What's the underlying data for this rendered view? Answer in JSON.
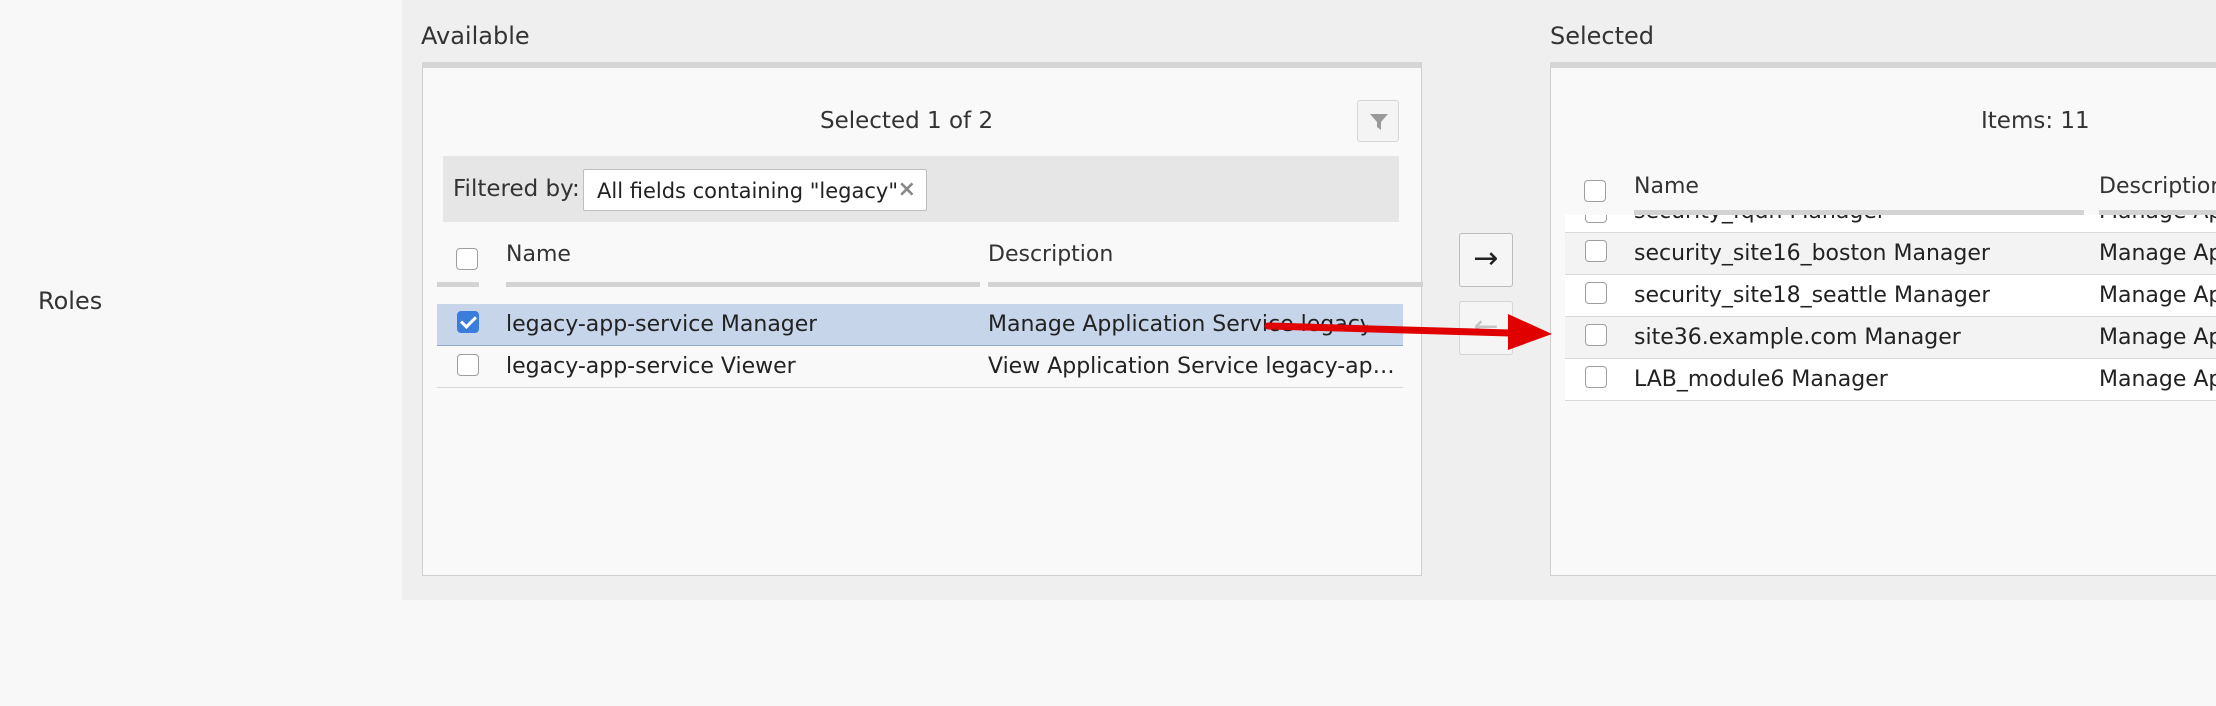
{
  "field_label": "Roles",
  "available": {
    "label": "Available",
    "title": "Selected 1 of 2",
    "filter_label": "Filtered by:",
    "filter_chip": "All fields containing \"legacy\"",
    "filter_chip_remove": "×",
    "columns": [
      "Name",
      "Description"
    ],
    "rows": [
      {
        "name": "legacy-app-service Manager",
        "description": "Manage Application Service legacy-ap",
        "checked": true
      },
      {
        "name": "legacy-app-service Viewer",
        "description": "View Application Service legacy-app-se…",
        "checked": false
      }
    ]
  },
  "transfer": {
    "add_label": "→",
    "remove_label": "←"
  },
  "selected": {
    "label": "Selected",
    "title": "Items: 11",
    "columns": [
      "Name",
      "Description"
    ],
    "rows": [
      {
        "name": "security_fqdn Manager",
        "description": "Manage App"
      },
      {
        "name": "security_site16_boston Manager",
        "description": "Manage App"
      },
      {
        "name": "security_site18_seattle Manager",
        "description": "Manage App"
      },
      {
        "name": "site36.example.com Manager",
        "description": "Manage App"
      },
      {
        "name": "LAB_module6 Manager",
        "description": "Manage App"
      }
    ]
  },
  "colors": {
    "selected_row": "#c6d5ea",
    "checkbox_checked": "#3b7ddd",
    "annotation_arrow": "#e00000"
  }
}
